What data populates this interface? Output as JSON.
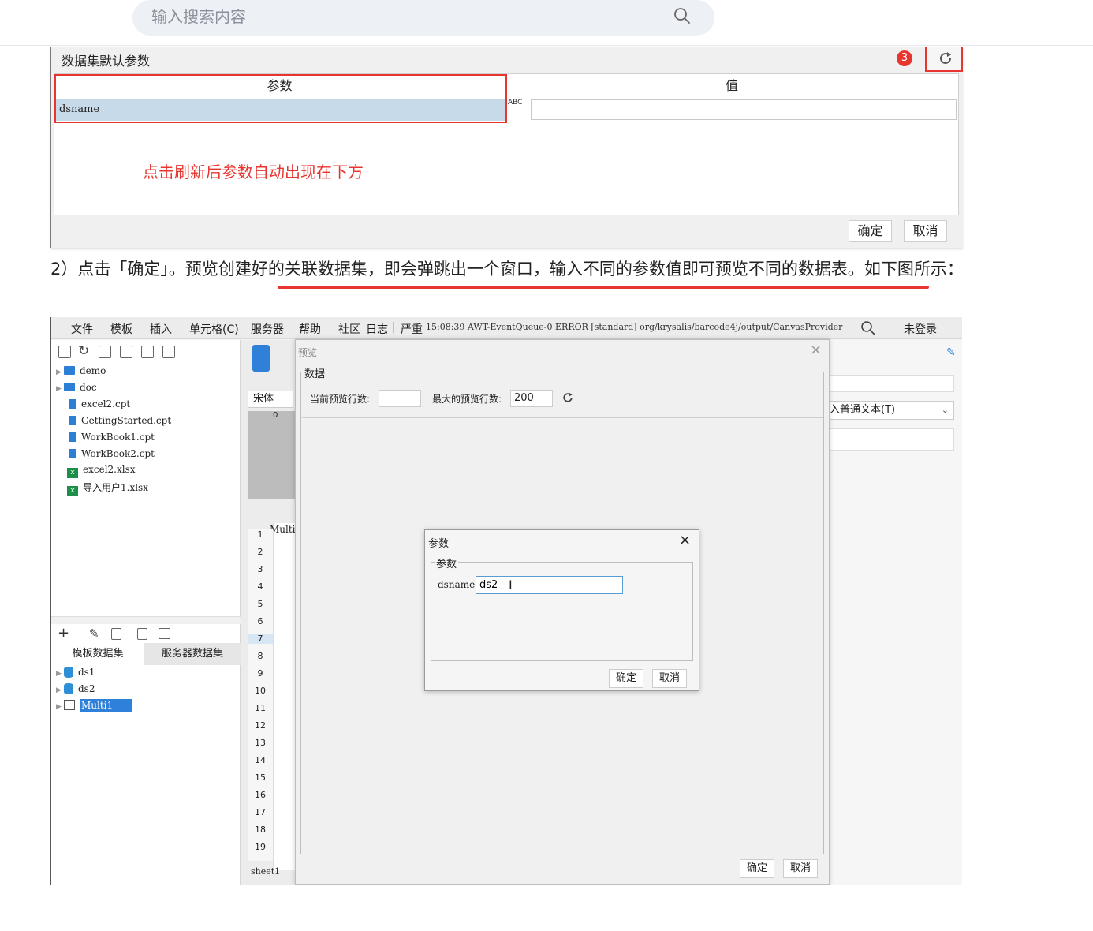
{
  "search": {
    "placeholder": "输入搜索内容",
    "icon": "search-icon"
  },
  "shot1": {
    "title": "数据集默认参数",
    "badge": "3",
    "col_param": "参数",
    "col_value": "值",
    "row_param": "dsname",
    "row_type_icon": "ABC",
    "note": "点击刷新后参数自动出现在下方",
    "ok": "确定",
    "cancel": "取消"
  },
  "step_text": "2）点击「确定」。预览创建好的关联数据集，即会弹跳出一个窗口，输入不同的参数值即可预览不同的数据表。如下图所示：",
  "designer": {
    "menu": [
      "文件",
      "模板",
      "插入",
      "单元格(C)",
      "服务器",
      "帮助",
      "社区",
      "日志",
      "|",
      "严重"
    ],
    "log_line": "15:08:39 AWT-EventQueue-0 ERROR [standard] org/krysalis/barcode4j/output/CanvasProvider",
    "login": "未登录",
    "file_tree": [
      {
        "name": "demo",
        "type": "folder"
      },
      {
        "name": "doc",
        "type": "folder"
      },
      {
        "name": "excel2.cpt",
        "type": "cpt"
      },
      {
        "name": "GettingStarted.cpt",
        "type": "cpt"
      },
      {
        "name": "WorkBook1.cpt",
        "type": "cpt"
      },
      {
        "name": "WorkBook2.cpt",
        "type": "cpt"
      },
      {
        "name": "excel2.xlsx",
        "type": "xlsx"
      },
      {
        "name": "导入用户1.xlsx",
        "type": "xlsx"
      }
    ],
    "tab_template_ds": "模板数据集",
    "tab_server_ds": "服务器数据集",
    "datasets": [
      "ds1",
      "ds2",
      "Multi1"
    ],
    "font_name": "宋体",
    "ruler_zero": "0",
    "cell_text": "Multi",
    "rows": [
      "1",
      "2",
      "3",
      "4",
      "5",
      "6",
      "7",
      "8",
      "9",
      "10",
      "11",
      "12",
      "13",
      "14",
      "15",
      "16",
      "17",
      "18",
      "19"
    ],
    "sheet": "sheet1",
    "right_select": "入普通文本(T)",
    "preview": {
      "title": "预览",
      "group": "数据",
      "cur_rows_label": "当前预览行数:",
      "cur_rows_value": "",
      "max_rows_label": "最大的预览行数:",
      "max_rows_value": "200",
      "ok": "确定",
      "cancel": "取消"
    },
    "params_dialog": {
      "title": "参数",
      "group": "参数",
      "name_label": "dsname:",
      "value": "ds2",
      "ok": "确定",
      "cancel": "取消"
    }
  },
  "colors": {
    "accent_red": "#e8352f",
    "selection_blue": "#2f80d8",
    "row_highlight": "#c6dae9"
  }
}
